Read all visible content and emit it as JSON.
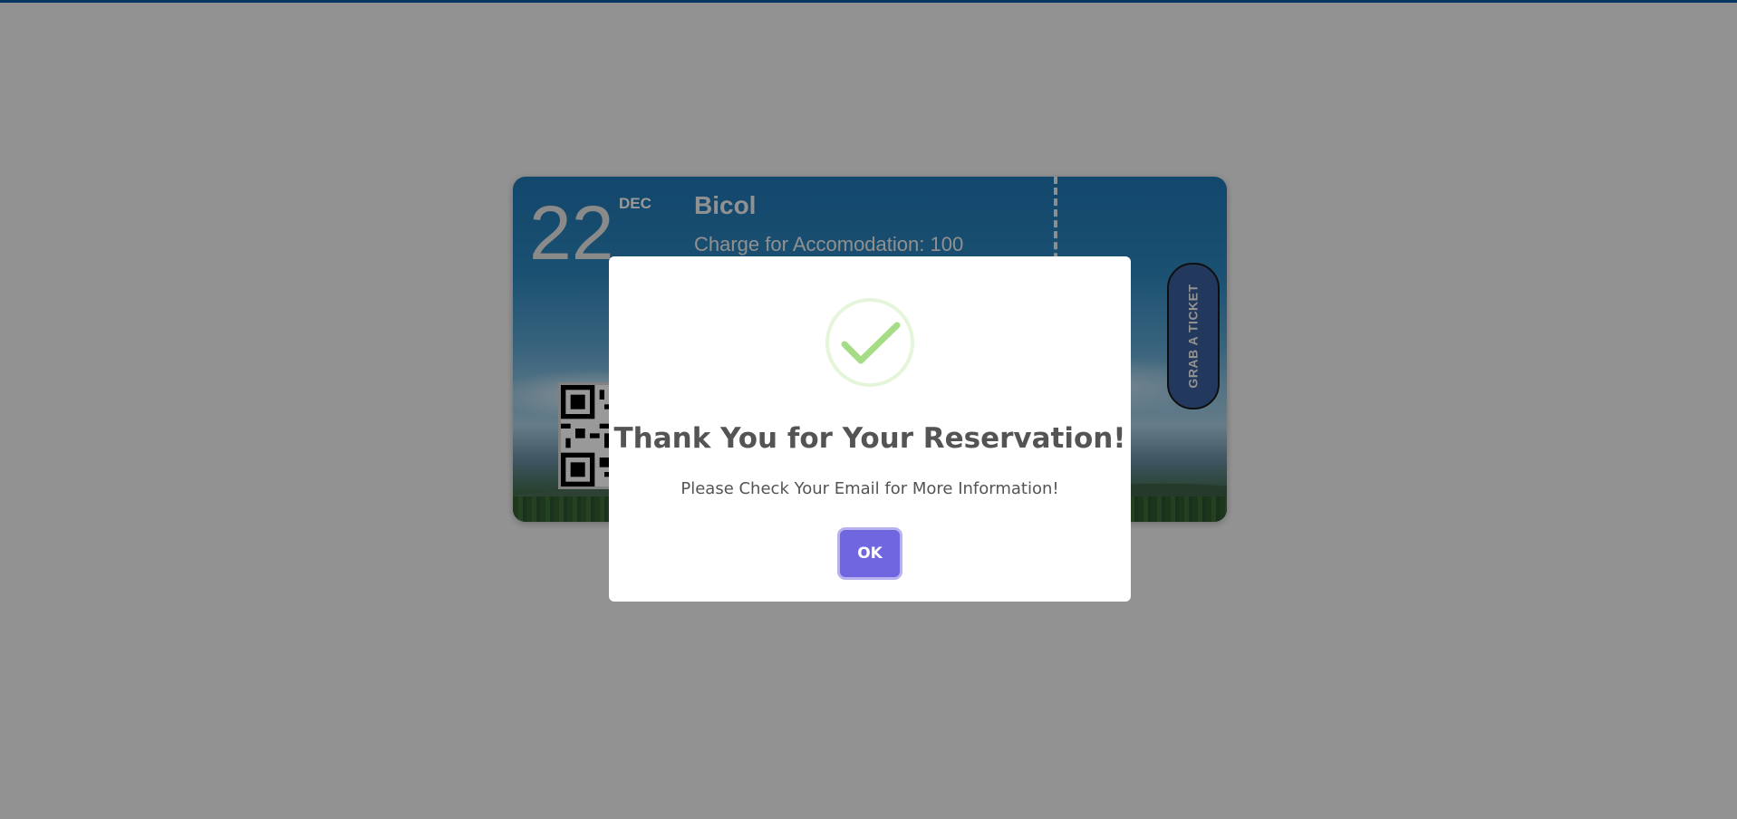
{
  "ticket": {
    "day": "22",
    "month": "DEC",
    "destination": "Bicol",
    "charge_text": "Charge for Accomodation: 100",
    "grab_button_label": "GRAB A TICKET"
  },
  "modal": {
    "icon": "success-check-icon",
    "title": "Thank You for Your Reservation!",
    "text": "Please Check Your Email for More Information!",
    "ok_label": "OK"
  },
  "colors": {
    "accent": "#7066e0",
    "success": "#a5dc86",
    "topbar": "#0d5aa7"
  }
}
